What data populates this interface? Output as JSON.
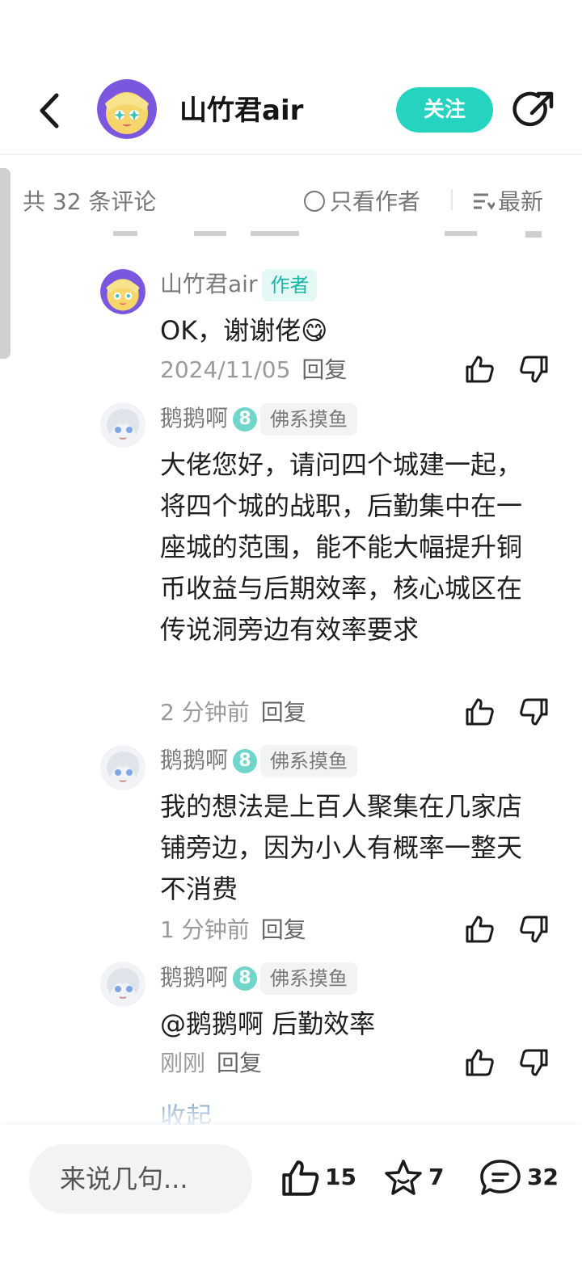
{
  "header": {
    "title": "山竹君air",
    "follow_label": "关注"
  },
  "filter_bar": {
    "count_label": "共 32 条评论",
    "only_author_label": "只看作者",
    "sort_label": "最新"
  },
  "comments": [
    {
      "author": "山竹君air",
      "author_tag": "作者",
      "text": "OK，谢谢佬😋",
      "time": "2024/11/05",
      "reply_label": "回复"
    },
    {
      "author": "鹅鹅啊",
      "level": "8",
      "group": "佛系摸鱼",
      "text": "大佬您好，请问四个城建一起，将四个城的战职，后勤集中在一座城的范围，能不能大幅提升铜币收益与后期效率，核心城区在传说洞旁边有效率要求",
      "time": "2 分钟前",
      "reply_label": "回复"
    },
    {
      "author": "鹅鹅啊",
      "level": "8",
      "group": "佛系摸鱼",
      "text": "我的想法是上百人聚集在几家店铺旁边，因为小人有概率一整天不消费",
      "time": "1 分钟前",
      "reply_label": "回复"
    },
    {
      "author": "鹅鹅啊",
      "level": "8",
      "group": "佛系摸鱼",
      "text": "@鹅鹅啊  后勤效率",
      "time": "刚刚",
      "reply_label": "回复"
    }
  ],
  "collapse_label": "收起",
  "footer": {
    "input_placeholder": "来说几句...",
    "likes": "15",
    "favorites": "7",
    "comments": "32"
  },
  "colors": {
    "accent": "#26d3c1",
    "link": "#2f6fa6",
    "muted": "#9a9a9a"
  }
}
